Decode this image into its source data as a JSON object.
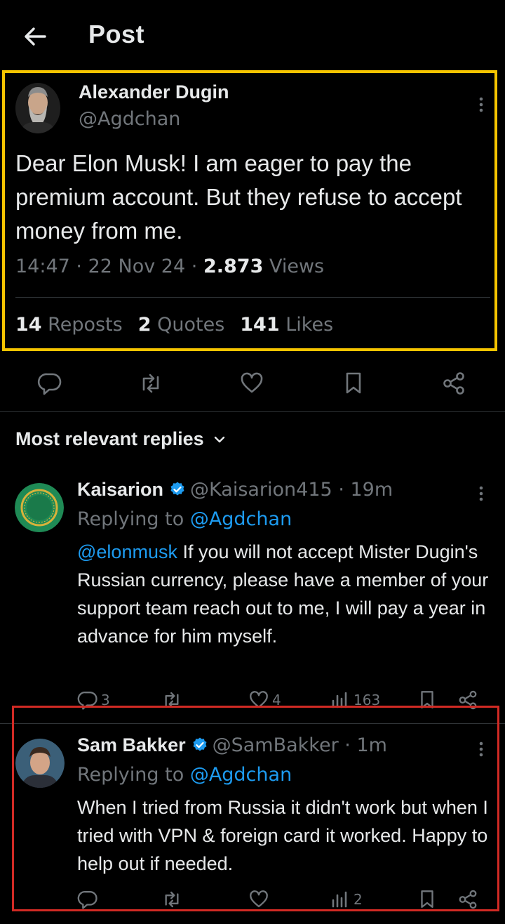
{
  "header": {
    "title": "Post"
  },
  "post": {
    "author_name": "Alexander Dugin",
    "author_handle": "@Agdchan",
    "text": "Dear Elon Musk! I am eager to pay the premium account. But they refuse to accept money from me.",
    "time": "14:47",
    "sep1": "·",
    "date": "22 Nov 24",
    "sep2": "·",
    "views": "2.873",
    "views_label": "Views",
    "reposts": "14",
    "reposts_label": "Reposts",
    "quotes": "2",
    "quotes_label": "Quotes",
    "likes": "141",
    "likes_label": "Likes"
  },
  "sort_label": "Most relevant replies",
  "replies": [
    {
      "name": "Kaisarion",
      "handle": "@Kaisarion415",
      "time": "· 19m",
      "replying_prefix": "Replying to",
      "replying_to": "@Agdchan",
      "mention": "@elonmusk",
      "text": " If you will not accept Mister Dugin's Russian currency, please have a member of your support team reach out to me, I will pay a year in advance for him myself.",
      "replies_count": "3",
      "reposts_count": "",
      "likes_count": "4",
      "views_count": "163"
    },
    {
      "name": "Sam Bakker",
      "handle": "@SamBakker",
      "time": "· 1m",
      "replying_prefix": "Replying to",
      "replying_to": "@Agdchan",
      "text": "When I tried from Russia it didn't work but when I tried with VPN & foreign card it worked. Happy to help out if needed.",
      "replies_count": "",
      "reposts_count": "",
      "likes_count": "",
      "views_count": "2"
    }
  ],
  "colors": {
    "background": "#000000",
    "text": "#e7e9ea",
    "muted": "#71767b",
    "link": "#1d9bf0",
    "highlight_yellow": "#f5c400",
    "highlight_red": "#d12a24"
  }
}
